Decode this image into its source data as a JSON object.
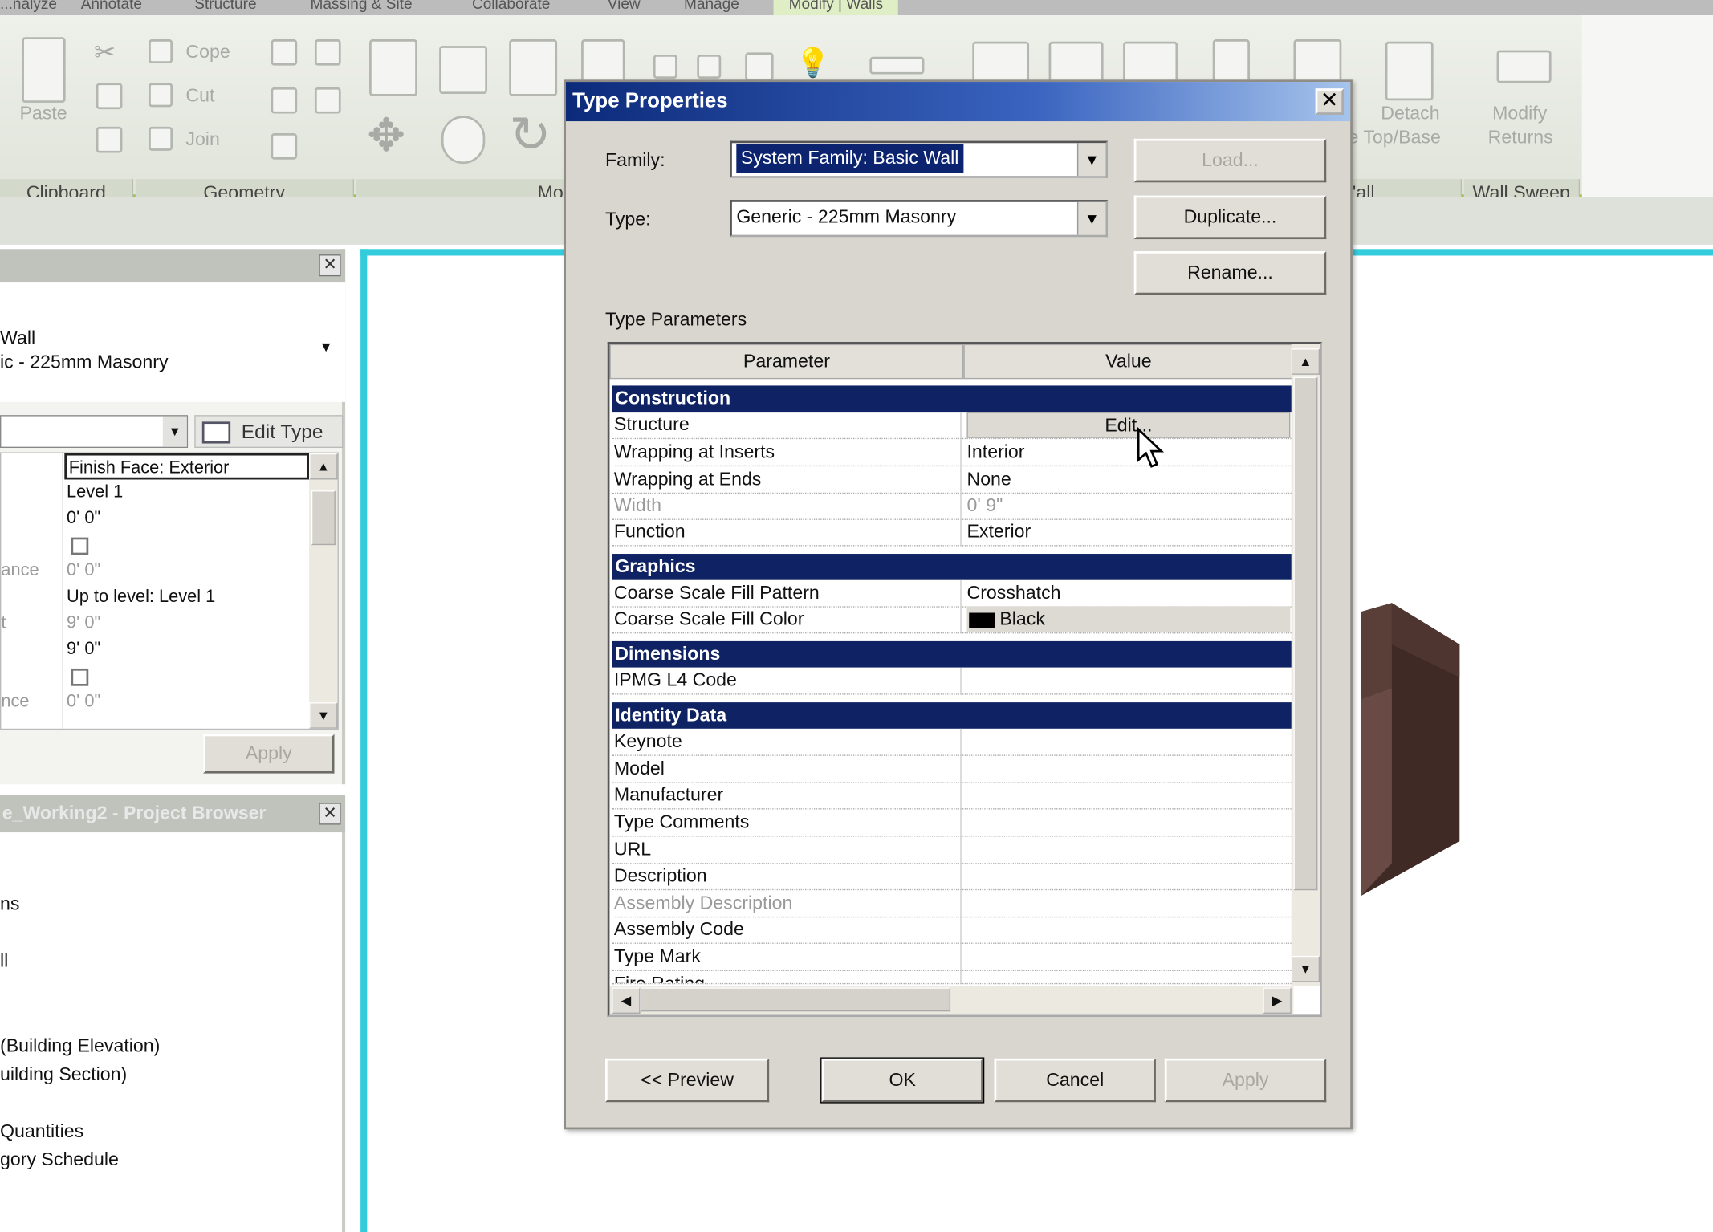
{
  "ribbon": {
    "menu_tabs": [
      "...nalyze",
      "Annotate",
      "Structure",
      "Massing & Site",
      "Collaborate",
      "View",
      "Manage",
      "Modify | Walls"
    ],
    "paste_label": "Paste",
    "cope_label": "Cope",
    "cut_label": "Cut",
    "join_label": "Join",
    "detach_label": "Detach",
    "top_base_label": "e Top/Base",
    "modify_label": "Modify",
    "returns_label": "Returns",
    "panels": {
      "clipboard": "Clipboard",
      "geometry": "Geometry",
      "modify": "Mo",
      "wall": "'all",
      "wall_sweep": "Wall Sweep"
    }
  },
  "properties": {
    "type_line1": "Wall",
    "type_line2": "ic - 225mm Masonry",
    "edit_type_label": "Edit Type",
    "apply_label": "Apply",
    "rows": [
      {
        "label": "",
        "value": "Finish Face: Exterior"
      },
      {
        "label": "",
        "value": "Level 1"
      },
      {
        "label": "",
        "value": "0'  0\""
      },
      {
        "label": "",
        "value": ""
      },
      {
        "label": "ance",
        "value": "0'  0\""
      },
      {
        "label": "",
        "value": "Up to level: Level 1"
      },
      {
        "label": "t",
        "value": "9'  0\""
      },
      {
        "label": "",
        "value": "9'  0\""
      },
      {
        "label": "",
        "value": ""
      },
      {
        "label": "nce",
        "value": "0'  0\""
      }
    ]
  },
  "browser": {
    "title": "e_Working2 - Project Browser",
    "items": [
      "ns",
      "ll",
      "(Building Elevation)",
      "uilding Section)",
      "Quantities",
      "gory Schedule"
    ]
  },
  "dialog": {
    "title": "Type Properties",
    "family_label": "Family:",
    "family_value": "System Family: Basic Wall",
    "type_label": "Type:",
    "type_value": "Generic - 225mm Masonry",
    "load_label": "Load...",
    "duplicate_label": "Duplicate...",
    "rename_label": "Rename...",
    "type_parameters_label": "Type Parameters",
    "col_parameter": "Parameter",
    "col_value": "Value",
    "groups": {
      "construction": "Construction",
      "graphics": "Graphics",
      "dimensions": "Dimensions",
      "identity": "Identity Data"
    },
    "construction_rows": [
      {
        "name": "Structure",
        "value": "Edit..."
      },
      {
        "name": "Wrapping at Inserts",
        "value": "Interior"
      },
      {
        "name": "Wrapping at Ends",
        "value": "None"
      },
      {
        "name": "Width",
        "value": "0'  9\""
      },
      {
        "name": "Function",
        "value": "Exterior"
      }
    ],
    "graphics_rows": [
      {
        "name": "Coarse Scale Fill Pattern",
        "value": "Crosshatch"
      },
      {
        "name": "Coarse Scale Fill Color",
        "value": "Black"
      }
    ],
    "dimensions_rows": [
      {
        "name": "IPMG L4 Code",
        "value": ""
      }
    ],
    "identity_rows": [
      {
        "name": "Keynote",
        "value": ""
      },
      {
        "name": "Model",
        "value": ""
      },
      {
        "name": "Manufacturer",
        "value": ""
      },
      {
        "name": "Type Comments",
        "value": ""
      },
      {
        "name": "URL",
        "value": ""
      },
      {
        "name": "Description",
        "value": ""
      },
      {
        "name": "Assembly Description",
        "value": ""
      },
      {
        "name": "Assembly Code",
        "value": ""
      },
      {
        "name": "Type Mark",
        "value": ""
      },
      {
        "name": "Fire Rating",
        "value": ""
      }
    ],
    "preview_label": "<< Preview",
    "ok_label": "OK",
    "cancel_label": "Cancel",
    "apply_label": "Apply"
  },
  "colors": {
    "group_header": "#0f2264",
    "view_border": "#33ccdd",
    "title_bar": "#0c2a7a"
  }
}
